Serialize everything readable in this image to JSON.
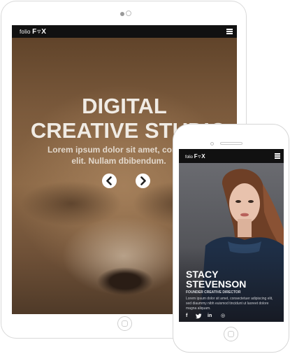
{
  "tablet": {
    "logo_small": "folio",
    "logo_big": "F▿X",
    "hero_title_line1": "DIGITAL",
    "hero_title_line2": "CREATIVE STUDIO",
    "hero_sub_line1": "Lorem ipsum dolor sit amet, consectetur",
    "hero_sub_line2": "elit. Nullam dbibendum.",
    "icons": [
      "menu-icon",
      "chevron-left-icon",
      "chevron-right-icon"
    ]
  },
  "phone": {
    "logo_small": "folio",
    "logo_big": "F▿X",
    "person_first_name": "STACY",
    "person_last_name": "STEVENSON",
    "person_role": "FOUNDER CREATIVE DIRECTOR",
    "person_bio": "Lorem ipsum dolor sit amet, consectetuer adipiscing elit, sed diaummy nibh euismod tincidunt ut laoreet dolore magna aliquam.",
    "social": {
      "facebook": "f",
      "twitter": "🐦",
      "linkedin": "in",
      "dribbble": "◎"
    }
  },
  "colors": {
    "bar": "#111111",
    "hero_text": "#f0ebe4",
    "device_border": "#d9d9d9"
  }
}
